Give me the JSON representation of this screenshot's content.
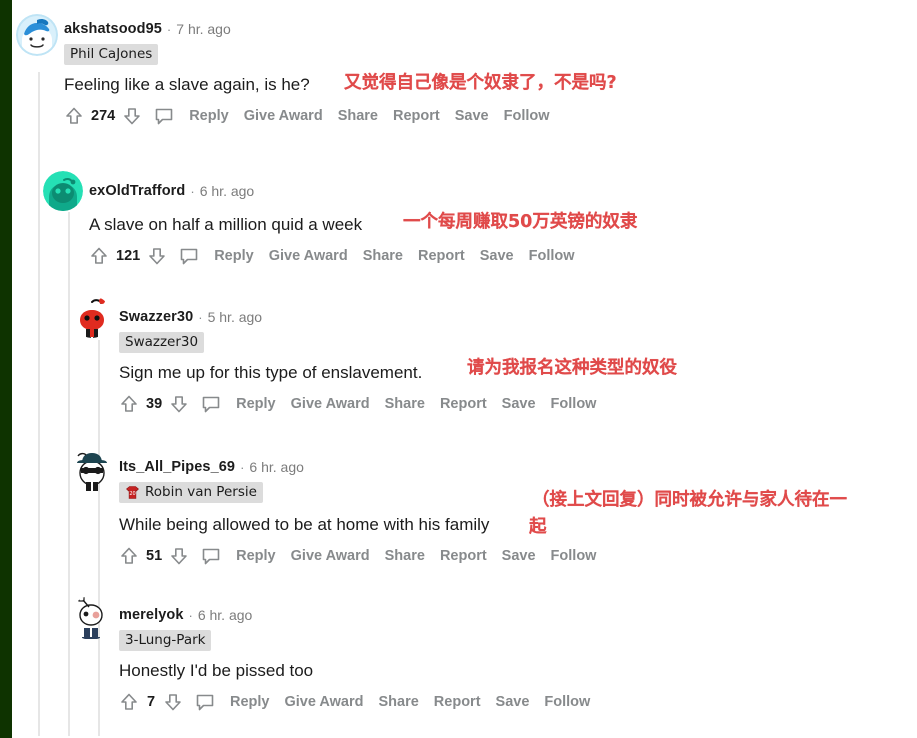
{
  "page": {
    "site": "reddit-comment-thread",
    "accent_red": "#e04a4a",
    "left_bar_color": "#0e3300",
    "background": "#ffffff"
  },
  "actions": {
    "reply": "Reply",
    "give_award": "Give Award",
    "share": "Share",
    "report": "Report",
    "save": "Save",
    "follow": "Follow"
  },
  "comments": [
    {
      "id": "c1",
      "author": "akshatsood95",
      "separator": "·",
      "time": "7 hr. ago",
      "flair": "Phil CaJones",
      "flair_icon": null,
      "body": "Feeling like a slave again, is he?",
      "score": "274",
      "avatar": "snoo-blue-avatar",
      "depth": 0,
      "annotation": "又觉得自己像是个奴隶了，不是吗?"
    },
    {
      "id": "c2",
      "author": "exOldTrafford",
      "separator": "·",
      "time": "6 hr. ago",
      "flair": null,
      "flair_icon": null,
      "body": "A slave on half a million quid a week",
      "score": "121",
      "avatar": "snoo-teal-avatar",
      "depth": 1,
      "annotation": "一个每周赚取50万英镑的奴隶"
    },
    {
      "id": "c3",
      "author": "Swazzer30",
      "separator": "·",
      "time": "5 hr. ago",
      "flair": "Swazzer30",
      "flair_icon": null,
      "body": "Sign me up for this type of enslavement.",
      "score": "39",
      "avatar": "snoo-red-avatar",
      "depth": 2,
      "annotation": "请为我报名这种类型的奴役"
    },
    {
      "id": "c4",
      "author": "Its_All_Pipes_69",
      "separator": "·",
      "time": "6 hr. ago",
      "flair": "Robin van Persie",
      "flair_icon": "red-jersey-icon",
      "body": "While being allowed to be at home with his family",
      "score": "51",
      "avatar": "snoo-hat-sunglasses-avatar",
      "depth": 2,
      "annotation_line1": "（接上文回复）同时被允许与家人待在一",
      "annotation_line2": "起"
    },
    {
      "id": "c5",
      "author": "merelyok",
      "separator": "·",
      "time": "6 hr. ago",
      "flair": "3-Lung-Park",
      "flair_icon": null,
      "body": "Honestly I'd be pissed too",
      "score": "7",
      "avatar": "snoo-antenna-avatar",
      "depth": 2,
      "annotation": null
    }
  ]
}
